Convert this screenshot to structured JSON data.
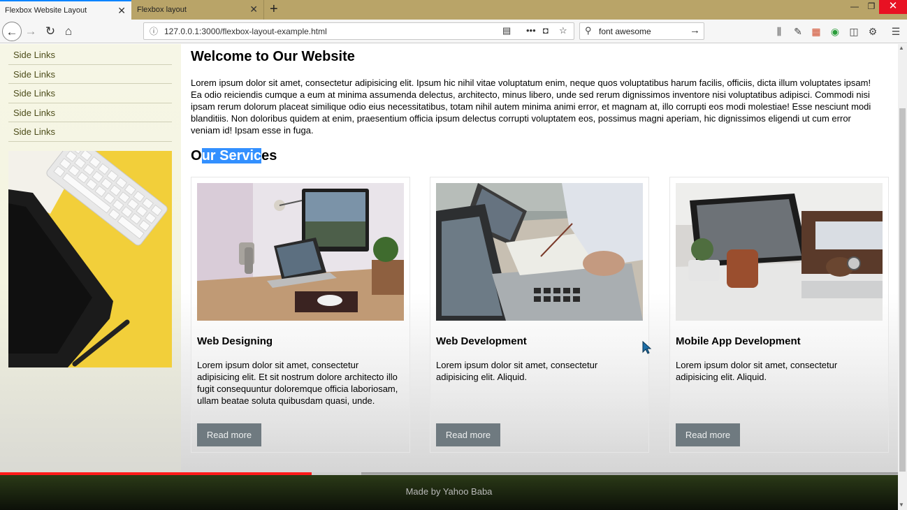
{
  "browser": {
    "tabs": [
      {
        "label": "Flexbox Website Layout",
        "active": true
      },
      {
        "label": "Flexbox layout",
        "active": false
      }
    ],
    "url": "127.0.0.1:3000/flexbox-layout-example.html",
    "search_value": "font awesome",
    "window_buttons": {
      "minimize": "—",
      "maximize": "❐",
      "close": "✕"
    }
  },
  "sidebar": {
    "links": [
      "Side Links",
      "Side Links",
      "Side Links",
      "Side Links",
      "Side Links"
    ]
  },
  "main": {
    "title": "Welcome to Our Website",
    "intro": "Lorem ipsum dolor sit amet, consectetur adipisicing elit. Ipsum hic nihil vitae voluptatum enim, neque quos voluptatibus harum facilis, officiis, dicta illum voluptates ipsam! Ea odio reiciendis cumque a eum at minima assumenda delectus, architecto, minus libero, unde sed rerum dignissimos inventore nisi voluptatibus adipisci. Commodi nisi ipsam rerum dolorum placeat similique odio eius necessitatibus, totam nihil autem minima animi error, et magnam at, illo corrupti eos modi molestiae! Esse nesciunt modi blanditiis. Non doloribus quidem at enim, praesentium officia ipsum delectus corrupti voluptatem eos, possimus magni aperiam, hic dignissimos eligendi ut cum error veniam id! Ipsam esse in fuga.",
    "services_title": {
      "before": "O",
      "selected": "ur Servic",
      "after": "es"
    },
    "cards": [
      {
        "title": "Web Designing",
        "text": "Lorem ipsum dolor sit amet, consectetur adipisicing elit. Et sit nostrum dolore architecto illo fugit consequuntur doloremque officia laboriosam, ullam beatae soluta quibusdam quasi, unde.",
        "button": "Read more"
      },
      {
        "title": "Web Development",
        "text": "Lorem ipsum dolor sit amet, consectetur adipisicing elit. Aliquid.",
        "button": "Read more"
      },
      {
        "title": "Mobile App Development",
        "text": "Lorem ipsum dolor sit amet, consectetur adipisicing elit. Aliquid.",
        "button": "Read more"
      }
    ]
  },
  "footer": {
    "text": "Made by Yahoo Baba"
  },
  "video": {
    "played_fraction": 0.347,
    "buffered_fraction": 0.402
  },
  "colors": {
    "tabbar": "#b9a468",
    "sidebar": "#f5f5e2",
    "button": "#6f7a80",
    "selection": "#3390ff",
    "progress": "#ff1a1a",
    "footer": "#1e2812"
  }
}
